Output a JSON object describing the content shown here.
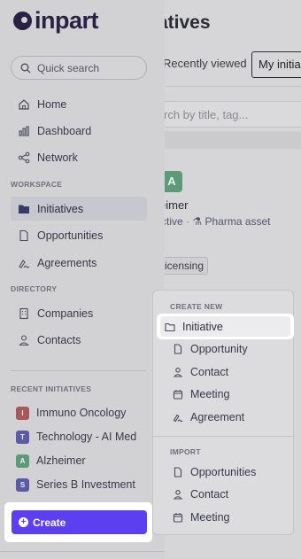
{
  "background": {
    "page_title": "atives",
    "tabs": [
      "Recently viewed",
      "My initia"
    ],
    "search_placeholder": "rch by title, tag...",
    "card": {
      "avatar_letter": "A",
      "name": "eimer",
      "status": "ctive",
      "type": "Pharma asset",
      "tag": "t-licensing"
    }
  },
  "sidebar": {
    "logo": "inpart",
    "quick_search": "Quick search",
    "main_nav": [
      {
        "label": "Home",
        "icon": "home-icon"
      },
      {
        "label": "Dashboard",
        "icon": "chart-icon"
      },
      {
        "label": "Network",
        "icon": "share-icon"
      }
    ],
    "workspace_title": "WORKSPACE",
    "workspace_nav": [
      {
        "label": "Initiatives",
        "icon": "folder-icon",
        "active": true
      },
      {
        "label": "Opportunities",
        "icon": "file-icon"
      },
      {
        "label": "Agreements",
        "icon": "signature-icon"
      }
    ],
    "directory_title": "DIRECTORY",
    "directory_nav": [
      {
        "label": "Companies",
        "icon": "building-icon"
      },
      {
        "label": "Contacts",
        "icon": "person-icon"
      }
    ],
    "recent_title": "RECENT INITIATIVES",
    "recent": [
      {
        "letter": "I",
        "label": "Immuno Oncology",
        "color": "#a85858"
      },
      {
        "letter": "T",
        "label": "Technology - AI Med",
        "color": "#5a5aa8"
      },
      {
        "letter": "A",
        "label": "Alzheimer",
        "color": "#5d9a7a"
      },
      {
        "letter": "S",
        "label": "Series B Investment",
        "color": "#5a5aa8"
      }
    ],
    "create_label": "Create"
  },
  "menu": {
    "create_new_title": "CREATE NEW",
    "create_items": [
      {
        "label": "Initiative",
        "icon": "folder-icon",
        "highlighted": true
      },
      {
        "label": "Opportunity",
        "icon": "file-icon"
      },
      {
        "label": "Contact",
        "icon": "person-icon"
      },
      {
        "label": "Meeting",
        "icon": "calendar-icon"
      },
      {
        "label": "Agreement",
        "icon": "signature-icon"
      }
    ],
    "import_title": "IMPORT",
    "import_items": [
      {
        "label": "Opportunities",
        "icon": "file-icon"
      },
      {
        "label": "Contact",
        "icon": "person-icon"
      },
      {
        "label": "Meeting",
        "icon": "calendar-icon"
      }
    ]
  }
}
